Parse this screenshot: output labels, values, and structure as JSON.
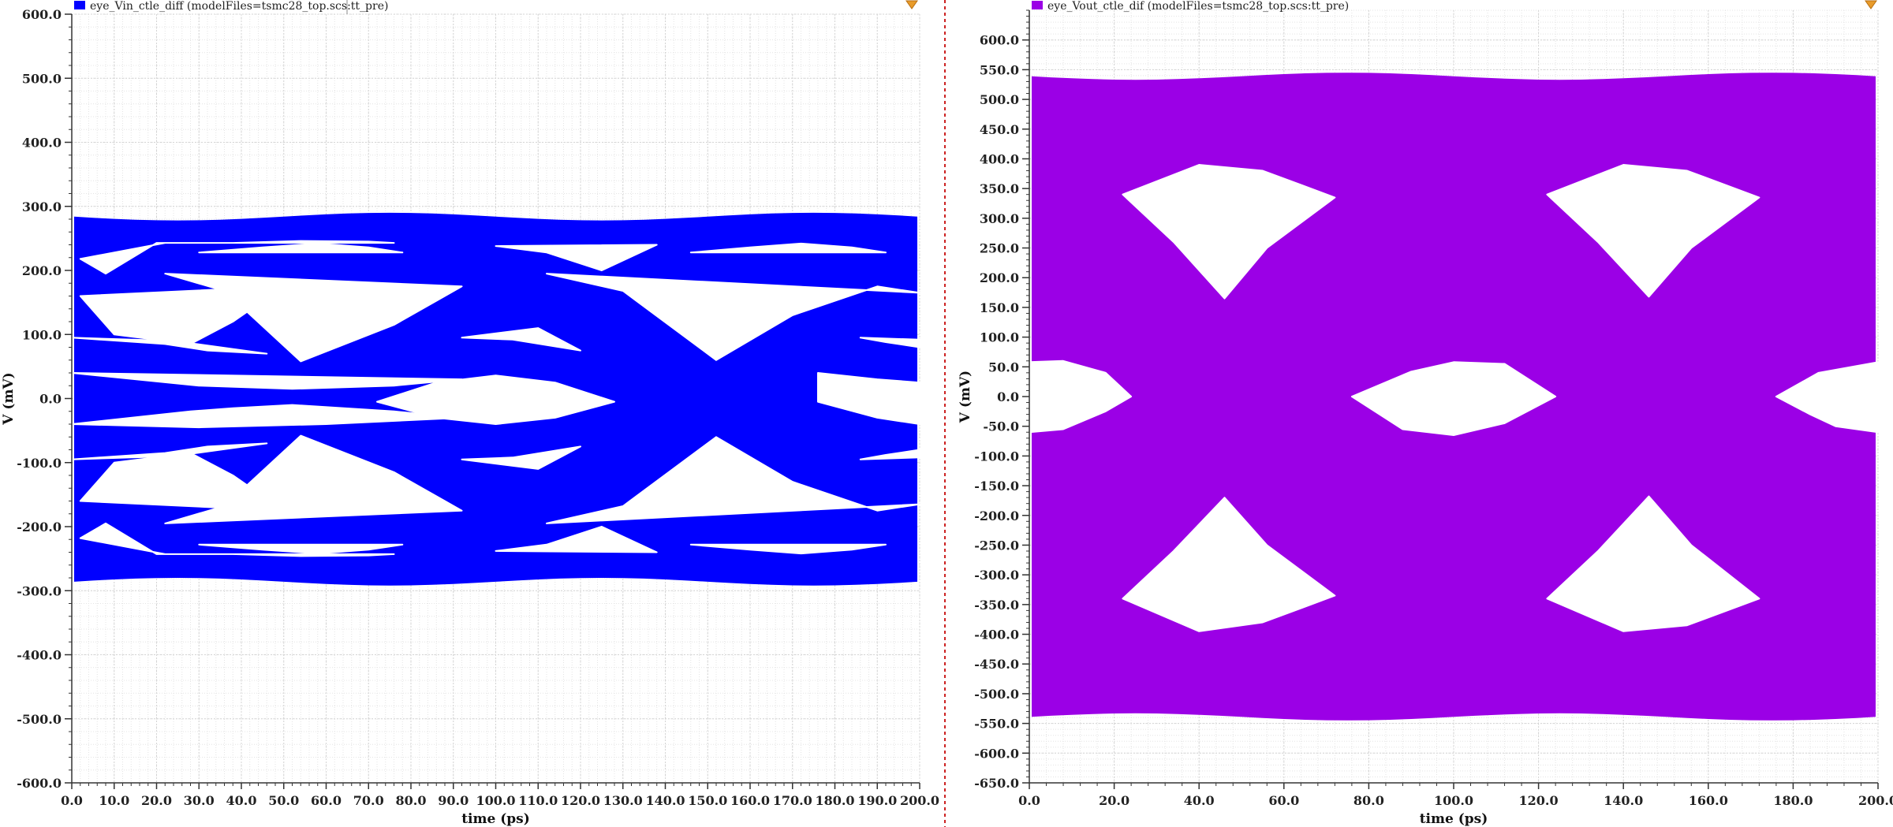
{
  "chart_data": [
    {
      "type": "eye_diagram",
      "legend": "eye_Vin_ctle_diff (modelFiles=tsmc28_top.scs:tt_pre)",
      "xlabel": "time (ps)",
      "ylabel": "V (mV)",
      "xlim": [
        0,
        200
      ],
      "ylim": [
        -600,
        600
      ],
      "x_ticks": [
        0,
        10,
        20,
        30,
        40,
        50,
        60,
        70,
        80,
        90,
        100,
        110,
        120,
        130,
        140,
        150,
        160,
        170,
        180,
        190,
        200
      ],
      "y_ticks": [
        600,
        500,
        400,
        300,
        200,
        100,
        0,
        -100,
        -200,
        -300,
        -400,
        -500,
        -600
      ],
      "x_tick_labels": [
        "0.0",
        "10.0",
        "20.0",
        "30.0",
        "40.0",
        "50.0",
        "60.0",
        "70.0",
        "80.0",
        "90.0",
        "100.0",
        "110.0",
        "120.0",
        "130.0",
        "140.0",
        "150.0",
        "160.0",
        "170.0",
        "180.0",
        "190.0",
        "200.0"
      ],
      "y_tick_labels": [
        "600.0",
        "500.0",
        "400.0",
        "300.0",
        "200.0",
        "100.0",
        "0.0",
        "-100.0",
        "-200.0",
        "-300.0",
        "-400.0",
        "-500.0",
        "-600.0"
      ],
      "color": "#0000ff",
      "grid": true,
      "legend_position": "top-left",
      "envelope_mV": [
        -290,
        288
      ],
      "eye_openings": [
        {
          "points": [
            [
              2,
              218
            ],
            [
              8,
              195
            ],
            [
              20,
              243
            ],
            [
              38,
              243
            ],
            [
              54,
              246
            ],
            [
              70,
              245
            ],
            [
              76,
              243
            ],
            [
              22,
              243
            ]
          ]
        },
        {
          "points": [
            [
              2,
              160
            ],
            [
              10,
              100
            ],
            [
              28,
              85
            ],
            [
              38,
              120
            ],
            [
              50,
              175
            ]
          ]
        },
        {
          "points": [
            [
              30,
              228
            ],
            [
              45,
              236
            ],
            [
              58,
              242
            ],
            [
              70,
              236
            ],
            [
              78,
              228
            ]
          ]
        },
        {
          "points": [
            [
              22,
              195
            ],
            [
              36,
              168
            ],
            [
              54,
              58
            ],
            [
              76,
              115
            ],
            [
              92,
              175
            ]
          ]
        },
        {
          "points": [
            [
              0,
              95
            ],
            [
              22,
              85
            ],
            [
              32,
              75
            ],
            [
              46,
              70
            ],
            [
              24,
              90
            ]
          ]
        },
        {
          "points": [
            [
              0,
              40
            ],
            [
              30,
              20
            ],
            [
              52,
              15
            ],
            [
              76,
              20
            ],
            [
              92,
              30
            ]
          ]
        },
        {
          "points": [
            [
              72,
              -5
            ],
            [
              86,
              25
            ],
            [
              100,
              36
            ],
            [
              114,
              25
            ],
            [
              128,
              -5
            ],
            [
              114,
              -30
            ],
            [
              100,
              -40
            ],
            [
              86,
              -30
            ]
          ]
        },
        {
          "points": [
            [
              92,
              95
            ],
            [
              110,
              110
            ],
            [
              120,
              75
            ],
            [
              104,
              92
            ]
          ]
        },
        {
          "points": [
            [
              100,
              238
            ],
            [
              112,
              228
            ],
            [
              125,
              200
            ],
            [
              138,
              240
            ]
          ]
        },
        {
          "points": [
            [
              112,
              195
            ],
            [
              130,
              168
            ],
            [
              152,
              60
            ],
            [
              170,
              130
            ],
            [
              190,
              175
            ],
            [
              200,
              165
            ]
          ]
        },
        {
          "points": [
            [
              146,
              228
            ],
            [
              160,
              236
            ],
            [
              172,
              242
            ],
            [
              184,
              236
            ],
            [
              192,
              228
            ]
          ]
        },
        {
          "points": [
            [
              186,
              95
            ],
            [
              200,
              92
            ],
            [
              200,
              80
            ],
            [
              192,
              88
            ]
          ]
        },
        {
          "points": [
            [
              176,
              40
            ],
            [
              190,
              30
            ],
            [
              200,
              25
            ],
            [
              200,
              -40
            ],
            [
              190,
              -30
            ],
            [
              176,
              -5
            ]
          ]
        },
        {
          "points": [
            [
              0,
              -40
            ],
            [
              14,
              -30
            ],
            [
              28,
              -20
            ],
            [
              38,
              -15
            ],
            [
              52,
              -10
            ],
            [
              76,
              -20
            ],
            [
              92,
              -30
            ],
            [
              60,
              -40
            ],
            [
              30,
              -45
            ]
          ]
        },
        {
          "points": [
            [
              0,
              -95
            ],
            [
              22,
              -85
            ],
            [
              32,
              -75
            ],
            [
              46,
              -70
            ],
            [
              24,
              -90
            ]
          ]
        },
        {
          "points": [
            [
              92,
              -95
            ],
            [
              104,
              -92
            ],
            [
              120,
              -75
            ],
            [
              110,
              -110
            ]
          ]
        },
        {
          "points": [
            [
              2,
              -160
            ],
            [
              10,
              -100
            ],
            [
              28,
              -85
            ],
            [
              38,
              -120
            ],
            [
              50,
              -175
            ]
          ]
        },
        {
          "points": [
            [
              22,
              -195
            ],
            [
              36,
              -168
            ],
            [
              54,
              -58
            ],
            [
              76,
              -115
            ],
            [
              92,
              -175
            ]
          ]
        },
        {
          "points": [
            [
              112,
              -195
            ],
            [
              130,
              -168
            ],
            [
              152,
              -60
            ],
            [
              170,
              -130
            ],
            [
              190,
              -175
            ],
            [
              200,
              -165
            ]
          ]
        },
        {
          "points": [
            [
              186,
              -95
            ],
            [
              200,
              -92
            ],
            [
              200,
              -80
            ],
            [
              192,
              -88
            ]
          ]
        },
        {
          "points": [
            [
              2,
              -218
            ],
            [
              8,
              -195
            ],
            [
              20,
              -243
            ],
            [
              38,
              -243
            ],
            [
              54,
              -246
            ],
            [
              70,
              -245
            ],
            [
              76,
              -243
            ],
            [
              22,
              -243
            ]
          ]
        },
        {
          "points": [
            [
              30,
              -228
            ],
            [
              45,
              -236
            ],
            [
              58,
              -242
            ],
            [
              70,
              -236
            ],
            [
              78,
              -228
            ]
          ]
        },
        {
          "points": [
            [
              100,
              -238
            ],
            [
              112,
              -228
            ],
            [
              125,
              -200
            ],
            [
              138,
              -240
            ]
          ]
        },
        {
          "points": [
            [
              146,
              -228
            ],
            [
              160,
              -236
            ],
            [
              172,
              -242
            ],
            [
              184,
              -236
            ],
            [
              192,
              -228
            ]
          ]
        }
      ]
    },
    {
      "type": "eye_diagram",
      "legend": "eye_Vout_ctle_dif (modelFiles=tsmc28_top.scs:tt_pre)",
      "xlabel": "time (ps)",
      "ylabel": "V (mV)",
      "xlim": [
        0,
        200
      ],
      "ylim": [
        -650,
        650
      ],
      "x_ticks": [
        0,
        20,
        40,
        60,
        80,
        100,
        120,
        140,
        160,
        180,
        200
      ],
      "y_ticks": [
        600,
        550,
        500,
        450,
        400,
        350,
        300,
        250,
        200,
        150,
        100,
        50,
        0,
        -50,
        -100,
        -150,
        -200,
        -250,
        -300,
        -350,
        -400,
        -450,
        -500,
        -550,
        -600,
        -650
      ],
      "x_tick_labels": [
        "0.0",
        "20.0",
        "40.0",
        "60.0",
        "80.0",
        "100.0",
        "120.0",
        "140.0",
        "160.0",
        "180.0",
        "200.0"
      ],
      "y_tick_labels": [
        "600.0",
        "550.0",
        "500.0",
        "450.0",
        "400.0",
        "350.0",
        "300.0",
        "250.0",
        "200.0",
        "150.0",
        "100.0",
        "50.0",
        "0.0",
        "-50.0",
        "-100.0",
        "-150.0",
        "-200.0",
        "-250.0",
        "-300.0",
        "-350.0",
        "-400.0",
        "-450.0",
        "-500.0",
        "-550.0",
        "-600.0",
        "-650.0"
      ],
      "color": "#9b00e6",
      "grid": true,
      "legend_position": "top-left",
      "envelope_mV": [
        -543,
        543
      ],
      "eye_openings": [
        {
          "points": [
            [
              22,
              340
            ],
            [
              40,
              390
            ],
            [
              55,
              380
            ],
            [
              72,
              335
            ],
            [
              56,
              250
            ],
            [
              46,
              165
            ],
            [
              34,
              260
            ]
          ]
        },
        {
          "points": [
            [
              122,
              340
            ],
            [
              140,
              390
            ],
            [
              155,
              380
            ],
            [
              172,
              335
            ],
            [
              156,
              250
            ],
            [
              146,
              168
            ],
            [
              134,
              260
            ]
          ]
        },
        {
          "points": [
            [
              0,
              58
            ],
            [
              8,
              60
            ],
            [
              18,
              40
            ],
            [
              24,
              0
            ],
            [
              18,
              -25
            ],
            [
              8,
              -55
            ],
            [
              0,
              -60
            ]
          ]
        },
        {
          "points": [
            [
              76,
              0
            ],
            [
              90,
              42
            ],
            [
              100,
              58
            ],
            [
              112,
              55
            ],
            [
              124,
              0
            ],
            [
              112,
              -45
            ],
            [
              100,
              -65
            ],
            [
              88,
              -55
            ]
          ]
        },
        {
          "points": [
            [
              176,
              0
            ],
            [
              186,
              40
            ],
            [
              200,
              58
            ],
            [
              200,
              -60
            ],
            [
              190,
              -50
            ],
            [
              184,
              -30
            ]
          ]
        },
        {
          "points": [
            [
              22,
              -340
            ],
            [
              34,
              -260
            ],
            [
              46,
              -170
            ],
            [
              56,
              -250
            ],
            [
              72,
              -335
            ],
            [
              55,
              -380
            ],
            [
              40,
              -395
            ]
          ]
        },
        {
          "points": [
            [
              122,
              -340
            ],
            [
              134,
              -260
            ],
            [
              146,
              -168
            ],
            [
              156,
              -250
            ],
            [
              172,
              -340
            ],
            [
              155,
              -385
            ],
            [
              140,
              -395
            ]
          ]
        }
      ]
    }
  ]
}
